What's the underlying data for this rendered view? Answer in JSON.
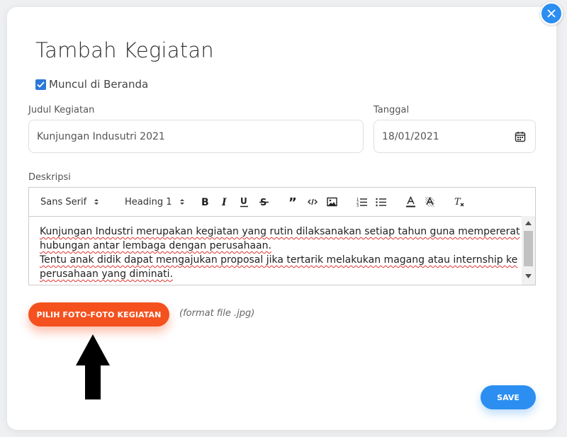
{
  "dialog": {
    "title": "Tambah Kegiatan",
    "show_on_home": {
      "label": "Muncul di Beranda",
      "checked": true
    }
  },
  "form": {
    "title_label": "Judul Kegiatan",
    "title_value": "Kunjungan Indusutri 2021",
    "date_label": "Tanggal",
    "date_value": "18/01/2021",
    "description_label": "Deskripsi"
  },
  "toolbar": {
    "font": "Sans Serif",
    "heading": "Heading 1",
    "buttons": [
      "bold-icon",
      "italic-icon",
      "underline-icon",
      "strike-icon",
      "blockquote-icon",
      "code-icon",
      "image-icon",
      "ordered-list-icon",
      "bullet-list-icon",
      "font-color-icon",
      "background-color-icon",
      "clear-format-icon"
    ]
  },
  "description": {
    "line1": "Kunjungan Industri merupakan kegiatan yang rutin dilaksanakan setiap tahun guna mempererat hubungan antar lembaga dengan perusahaan.",
    "line2": "Tentu anak didik dapat mengajukan proposal jika tertarik melakukan magang atau internship ke perusahaan yang diminati."
  },
  "upload": {
    "button_label": "PILIH FOTO-FOTO KEGIATAN",
    "format_note": "(format file .jpg)"
  },
  "actions": {
    "save_label": "SAVE"
  },
  "colors": {
    "primary": "#2b8ef0",
    "accent": "#f4511e",
    "checkbox": "#2b78d8"
  }
}
